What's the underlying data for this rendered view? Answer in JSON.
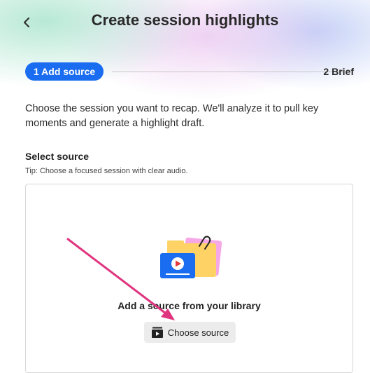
{
  "header": {
    "back_icon": "chevron-left-icon",
    "title": "Create session highlights"
  },
  "stepper": {
    "step1_label": "1 Add source",
    "step2_label": "2 Brief",
    "accent_color": "#1a6cf0"
  },
  "description": "Choose the session you want to recap. We'll analyze it to pull key moments and generate a highlight draft.",
  "source": {
    "label": "Select source",
    "tip": "Tip: Choose a focused session with clear audio.",
    "dropzone_title": "Add a source from your library",
    "illustration_icon": "video-folder-illustration",
    "button_icon": "library-play-icon",
    "button_label": "Choose source"
  },
  "annotation": {
    "arrow_color": "#e0347f"
  }
}
